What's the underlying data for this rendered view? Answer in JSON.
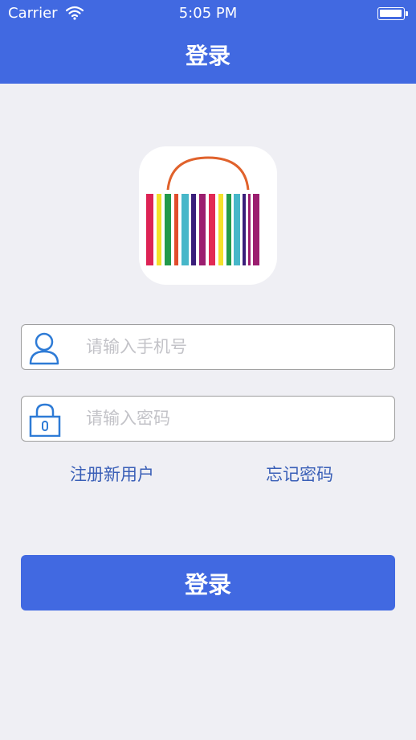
{
  "status_bar": {
    "carrier": "Carrier",
    "time": "5:05 PM"
  },
  "nav": {
    "title": "登录"
  },
  "form": {
    "phone_placeholder": "请输入手机号",
    "phone_value": "",
    "password_placeholder": "请输入密码",
    "password_value": ""
  },
  "links": {
    "register": "注册新用户",
    "forgot": "忘记密码"
  },
  "login_button": {
    "label": "登录"
  },
  "icons": {
    "user": "user-icon",
    "lock": "lock-icon",
    "logo": "barcode-bag-logo"
  },
  "colors": {
    "brand": "#4169e1",
    "link": "#3a5fb7",
    "background": "#efeff4",
    "icon": "#2e7bd6",
    "bag_handle": "#e0622c"
  }
}
